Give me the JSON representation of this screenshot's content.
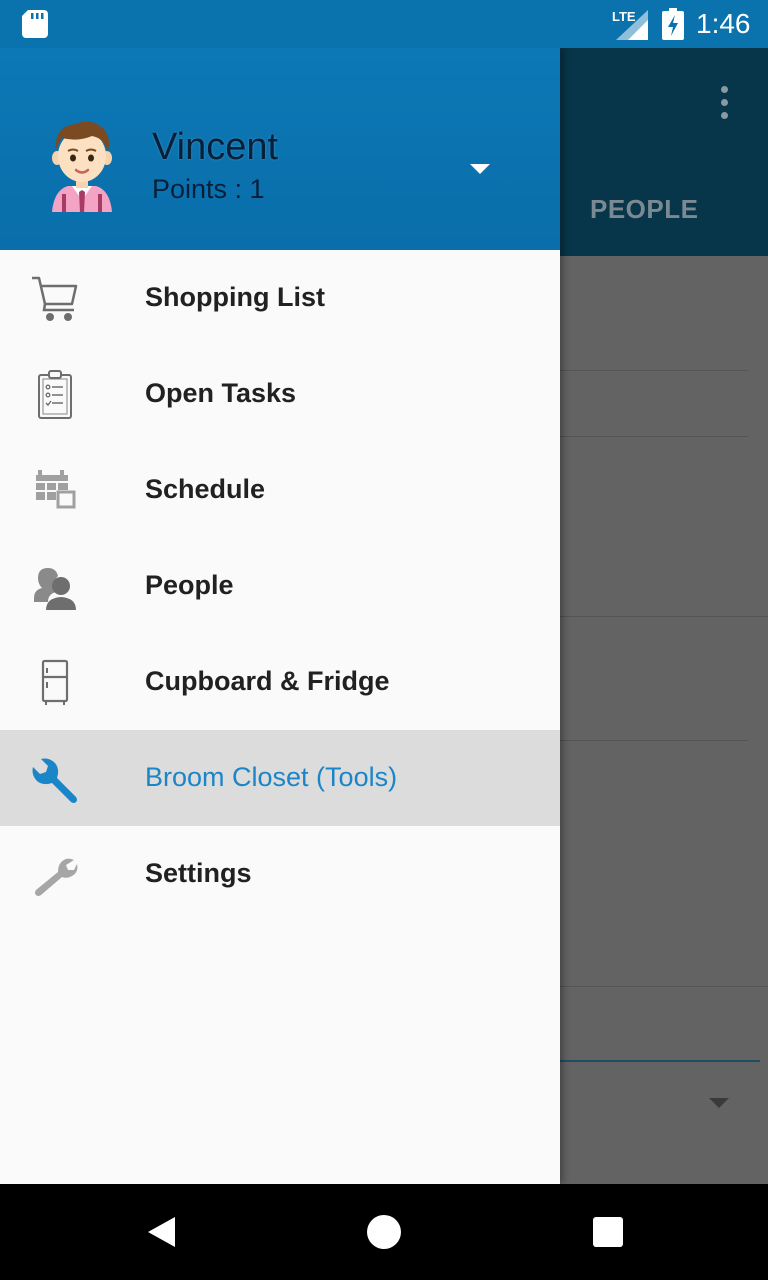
{
  "status_bar": {
    "network": "LTE",
    "time": "1:46"
  },
  "background_app": {
    "tab_label": "PEOPLE",
    "more_icon": "more-vert-icon"
  },
  "drawer": {
    "user": {
      "name": "Vincent",
      "points": "Points : 1",
      "avatar_icon": "boy-avatar-icon"
    },
    "account_toggle_icon": "arrow-drop-down-icon",
    "items": [
      {
        "label": "Shopping List",
        "icon": "cart-icon"
      },
      {
        "label": "Open Tasks",
        "icon": "clipboard-icon"
      },
      {
        "label": "Schedule",
        "icon": "calendar-icon"
      },
      {
        "label": "People",
        "icon": "people-icon"
      },
      {
        "label": "Cupboard & Fridge",
        "icon": "fridge-icon"
      },
      {
        "label": "Broom Closet (Tools)",
        "icon": "wrench-icon",
        "active": true
      },
      {
        "label": "Settings",
        "icon": "settings-wrench-icon"
      }
    ],
    "accent_color": "#1a86c7",
    "header_color": "#0a72ad"
  },
  "nav_bar": {
    "back_icon": "back-triangle-icon",
    "home_icon": "home-circle-icon",
    "recent_icon": "recent-square-icon"
  }
}
